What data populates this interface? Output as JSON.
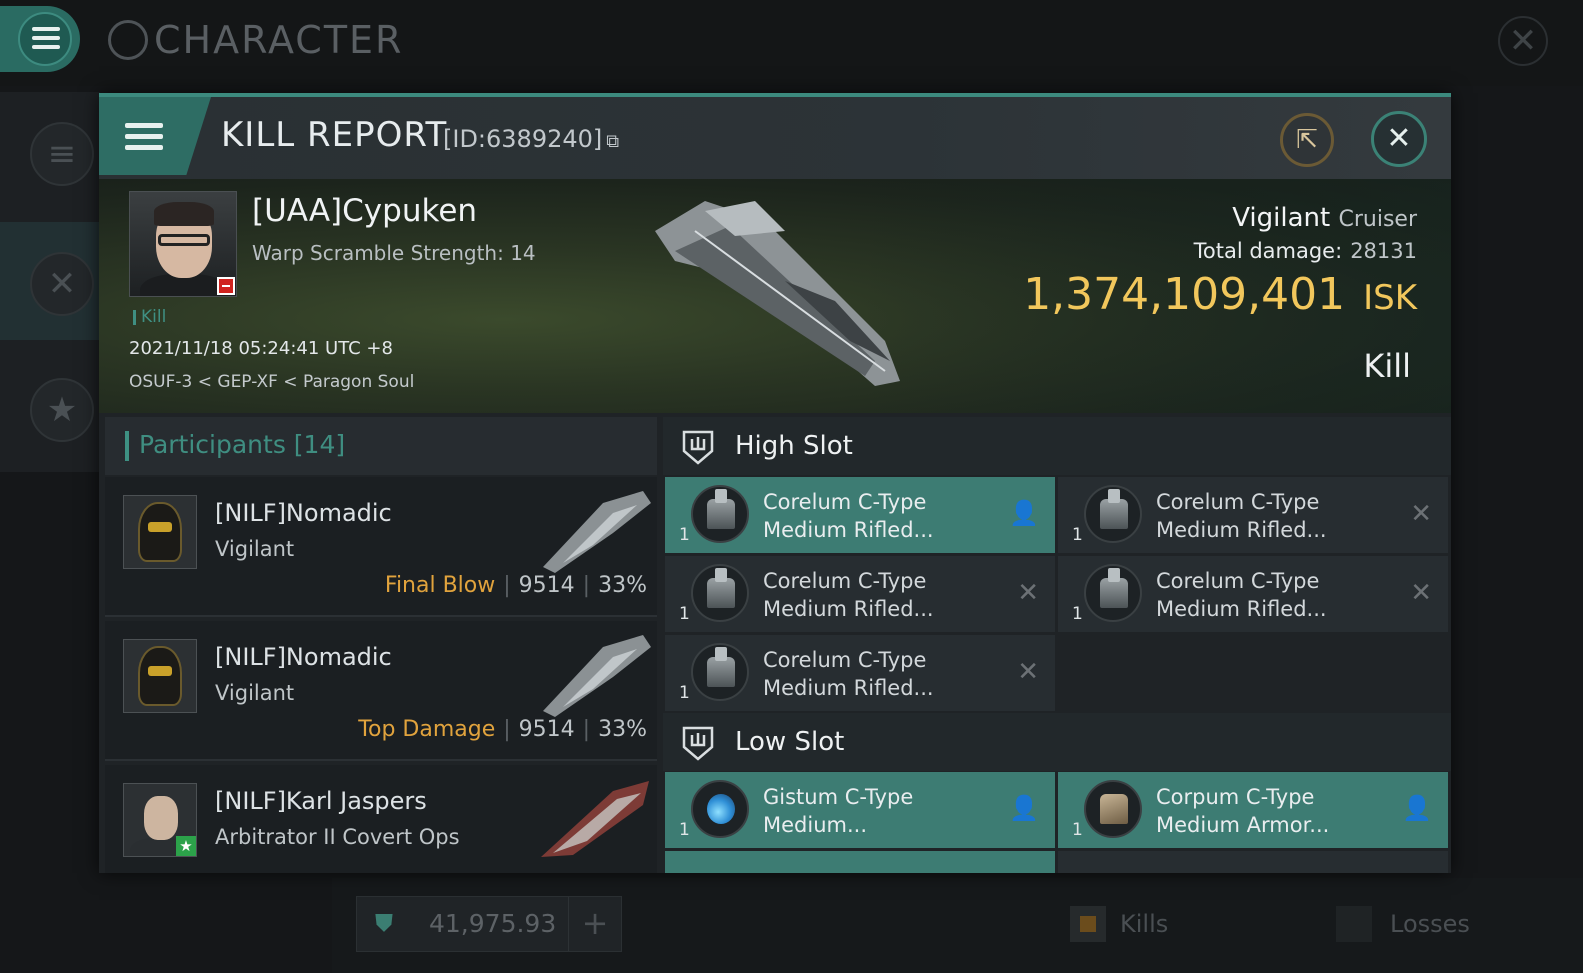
{
  "app": {
    "title": "CHARACTER",
    "isk_balance": "41,975.93",
    "add_label": "+",
    "kills_label": "Kills",
    "losses_label": "Losses"
  },
  "dialog": {
    "title": "KILL REPORT",
    "id_label": "[ID:6389240]"
  },
  "victim": {
    "name": "[UAA]Cypuken",
    "warp": "Warp Scramble Strength: 14",
    "tag": "Kill",
    "datetime": "2021/11/18 05:24:41 UTC +8",
    "location": "OSUF-3 < GEP-XF < Paragon Soul",
    "ship": "Vigilant",
    "ship_class": "Cruiser",
    "damage_label": "Total damage:",
    "damage_value": "28131",
    "isk_value": "1,374,109,401",
    "isk_unit": "ISK",
    "result": "Kill"
  },
  "participants": {
    "header": "Participants [14]",
    "rows": [
      {
        "name": "[NILF]Nomadic",
        "ship": "Vigilant",
        "tag": "Final Blow",
        "damage": "9514",
        "percent": "33%"
      },
      {
        "name": "[NILF]Nomadic",
        "ship": "Vigilant",
        "tag": "Top Damage",
        "damage": "9514",
        "percent": "33%"
      },
      {
        "name": "[NILF]Karl Jaspers",
        "ship": "Arbitrator II Covert Ops"
      }
    ]
  },
  "high_slot": {
    "title": "High Slot",
    "modules": [
      {
        "l1": "Corelum C-Type",
        "l2": "Medium Rifled...",
        "qty": "1"
      },
      {
        "l1": "Corelum C-Type",
        "l2": "Medium Rifled...",
        "qty": "1"
      },
      {
        "l1": "Corelum C-Type",
        "l2": "Medium Rifled...",
        "qty": "1"
      },
      {
        "l1": "Corelum C-Type",
        "l2": "Medium Rifled...",
        "qty": "1"
      },
      {
        "l1": "Corelum C-Type",
        "l2": "Medium Rifled...",
        "qty": "1"
      }
    ]
  },
  "low_slot": {
    "title": "Low Slot",
    "modules": [
      {
        "l1": "Gistum C-Type",
        "l2": "Medium...",
        "qty": "1"
      },
      {
        "l1": "Corpum C-Type",
        "l2": "Medium Armor...",
        "qty": "1"
      }
    ]
  },
  "colors": {
    "accent": "#3d7c73",
    "isk_gold": "#f2c75c",
    "tag_orange": "#e1a33d"
  }
}
